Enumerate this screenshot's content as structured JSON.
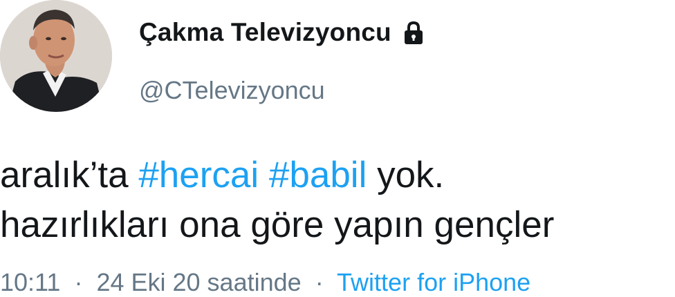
{
  "author": {
    "display_name": "Çakma Televizyoncu",
    "handle": "@CTelevizyoncu",
    "protected_icon": "lock-icon",
    "avatar_icon": "profile-photo"
  },
  "tweet": {
    "line1_prefix": "aralık’ta ",
    "hashtag1": "#hercai",
    "space": " ",
    "hashtag2": "#babil",
    "line1_suffix": " yok.",
    "line2": "hazırlıkları ona göre yapın gençler"
  },
  "meta": {
    "time": "10:11",
    "separator": "·",
    "date": "24 Eki 20 saatinde",
    "source": "Twitter for iPhone"
  },
  "colors": {
    "link": "#1da1f2",
    "muted": "#657786",
    "text": "#14171a"
  }
}
